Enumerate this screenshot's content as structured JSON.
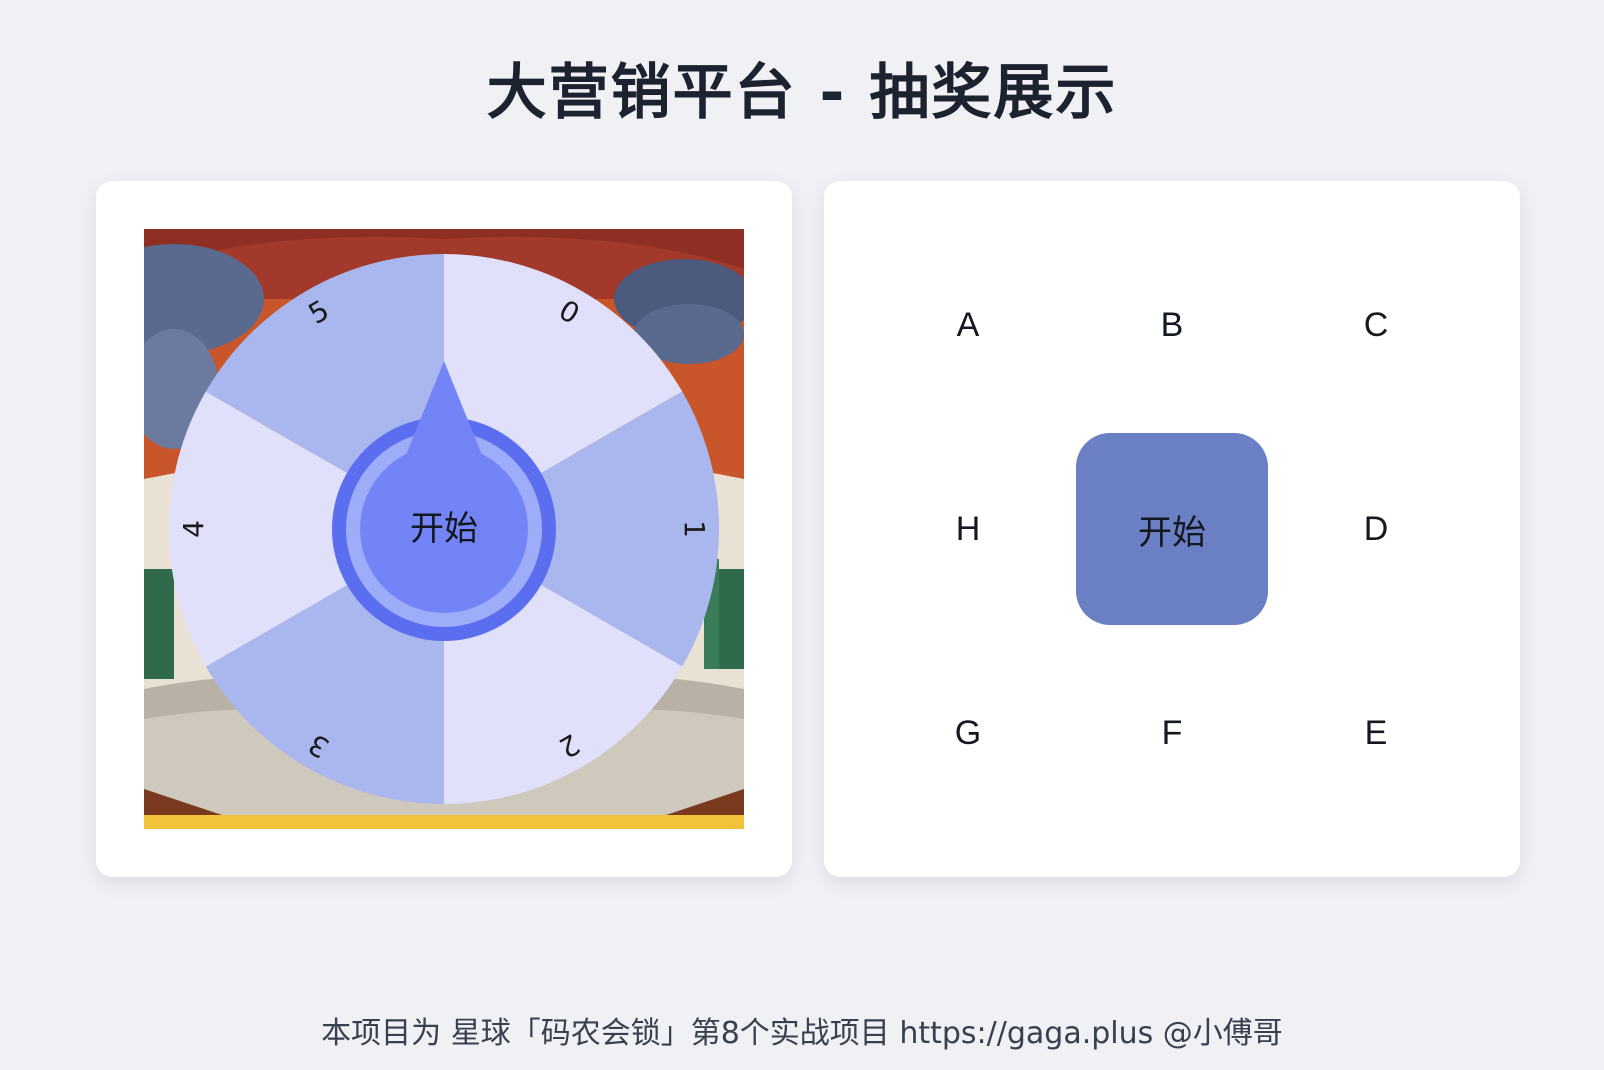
{
  "header": {
    "title": "大营销平台 - 抽奖展示"
  },
  "wheel": {
    "segments": [
      {
        "label": "0",
        "color": "#e1e0fb"
      },
      {
        "label": "1",
        "color": "#aab7ee"
      },
      {
        "label": "2",
        "color": "#e1e0fb"
      },
      {
        "label": "3",
        "color": "#aab7ee"
      },
      {
        "label": "4",
        "color": "#e1e0fb"
      },
      {
        "label": "5",
        "color": "#aab7ee"
      }
    ],
    "start_label": "开始",
    "pointer_color": "#7384f7",
    "ring_color": "#5b6ef0",
    "inner_ring_color": "#9eadf9"
  },
  "grid": {
    "cells": [
      {
        "label": "A"
      },
      {
        "label": "B"
      },
      {
        "label": "C"
      },
      {
        "label": "H"
      },
      {
        "label": "开始"
      },
      {
        "label": "D"
      },
      {
        "label": "G"
      },
      {
        "label": "F"
      },
      {
        "label": "E"
      }
    ],
    "start_color": "#6b80c4"
  },
  "footer": {
    "text": "本项目为 星球「码农会锁」第8个实战项目 https://gaga.plus @小傅哥"
  }
}
